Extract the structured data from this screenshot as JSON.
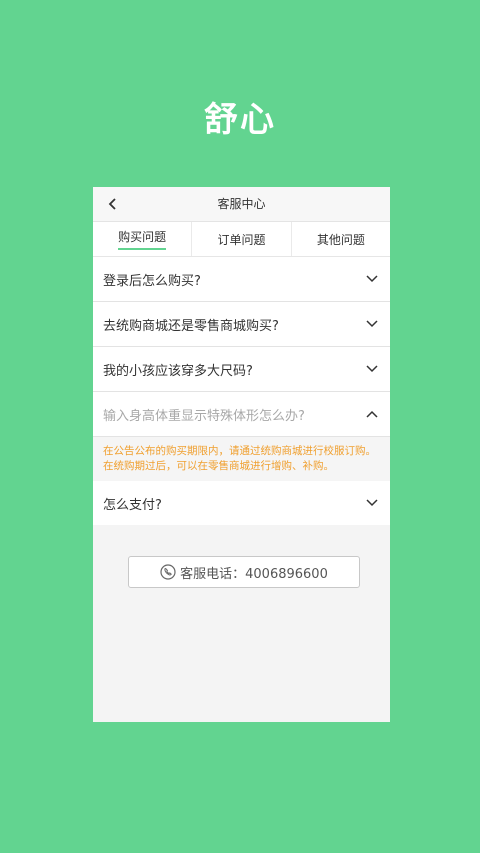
{
  "brand": {
    "name": "舒心"
  },
  "header": {
    "title": "客服中心"
  },
  "tabs": [
    {
      "label": "购买问题",
      "active": true
    },
    {
      "label": "订单问题",
      "active": false
    },
    {
      "label": "其他问题",
      "active": false
    }
  ],
  "faq": [
    {
      "question": "登录后怎么购买?",
      "expanded": false
    },
    {
      "question": "去统购商城还是零售商城购买?",
      "expanded": false
    },
    {
      "question": "我的小孩应该穿多大尺码?",
      "expanded": false
    },
    {
      "question": "输入身高体重显示特殊体形怎么办?",
      "expanded": true,
      "answer": "在公告公布的购买期限内，请通过统购商城进行校服订购。在统购期过后，可以在零售商城进行增购、补购。"
    },
    {
      "question": "怎么支付?",
      "expanded": false
    }
  ],
  "contact": {
    "label": "客服电话：4006896600"
  },
  "colors": {
    "accent": "#62d490",
    "answer": "#f0a030"
  }
}
